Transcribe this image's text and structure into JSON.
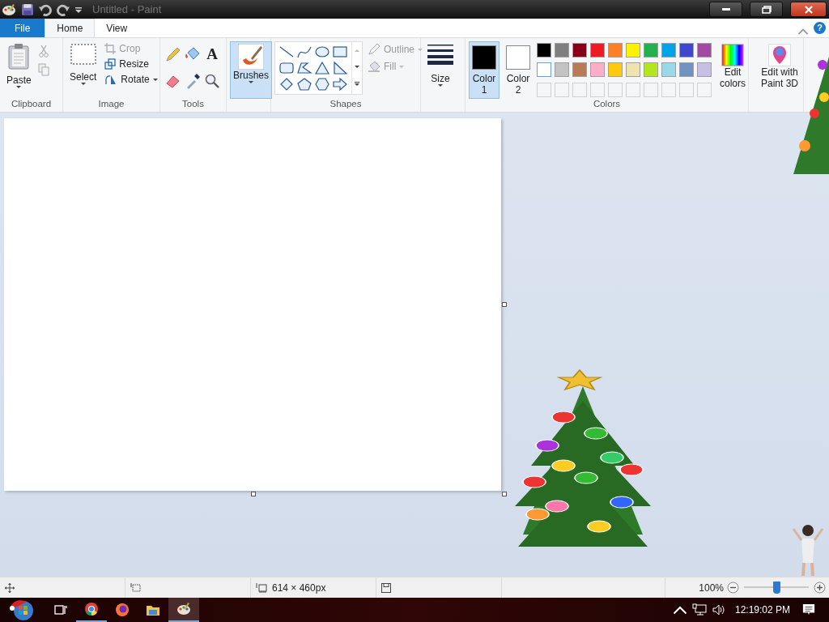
{
  "window": {
    "title": "Untitled - Paint"
  },
  "tabs": [
    {
      "label": "File",
      "selected": false,
      "kind": "file"
    },
    {
      "label": "Home",
      "selected": true,
      "kind": "tab"
    },
    {
      "label": "View",
      "selected": false,
      "kind": "tab"
    }
  ],
  "clipboard": {
    "title": "Clipboard",
    "paste": "Paste"
  },
  "image": {
    "title": "Image",
    "select": "Select",
    "items": [
      {
        "label": "Crop",
        "disabled": true,
        "kind": "crop"
      },
      {
        "label": "Resize",
        "disabled": false,
        "kind": "resize"
      },
      {
        "label": "Rotate",
        "disabled": false,
        "kind": "rotate"
      }
    ]
  },
  "tools": {
    "title": "Tools",
    "text_tool": "A"
  },
  "help": "?",
  "brushes": {
    "label": "Brushes",
    "selected": true
  },
  "shapes": {
    "title": "Shapes",
    "outline": {
      "label": "Outline",
      "disabled": true
    },
    "fill": {
      "label": "Fill",
      "disabled": true
    }
  },
  "size": {
    "label": "Size"
  },
  "colors": {
    "title": "Colors",
    "active": [
      {
        "label": "Color 1",
        "color": "#000000",
        "selected": true
      },
      {
        "label": "Color 2",
        "color": "#ffffff",
        "selected": false
      }
    ],
    "palette": [
      {
        "color": "#000000"
      },
      {
        "color": "#7f7f7f"
      },
      {
        "color": "#880015"
      },
      {
        "color": "#ed1c24"
      },
      {
        "color": "#ff7f27"
      },
      {
        "color": "#fff200"
      },
      {
        "color": "#22b14c"
      },
      {
        "color": "#00a2e8"
      },
      {
        "color": "#3f48cc"
      },
      {
        "color": "#a349a4"
      },
      {
        "color": "#ffffff"
      },
      {
        "color": "#c3c3c3"
      },
      {
        "color": "#b97a57"
      },
      {
        "color": "#ffaec9"
      },
      {
        "color": "#ffc90e"
      },
      {
        "color": "#efe4b0"
      },
      {
        "color": "#b5e61d"
      },
      {
        "color": "#99d9ea"
      },
      {
        "color": "#7092be"
      },
      {
        "color": "#c8bfe7"
      }
    ],
    "custom": [
      {
        "filled": false
      },
      {
        "filled": false
      },
      {
        "filled": false
      },
      {
        "filled": false
      },
      {
        "filled": false
      },
      {
        "filled": false
      },
      {
        "filled": false
      },
      {
        "filled": false
      },
      {
        "filled": false
      },
      {
        "filled": false
      }
    ],
    "edit": "Edit colors"
  },
  "paint3d": {
    "label": "Edit with Paint 3D"
  },
  "status_bar": {
    "image_size": "614 × 460px",
    "zoom": "100%",
    "level": 0.5
  },
  "taskbar": {
    "apps": [
      {
        "kind": "chrome",
        "selected": false,
        "running": true
      },
      {
        "kind": "firefox",
        "selected": false,
        "running": false
      },
      {
        "kind": "explorer",
        "selected": false,
        "running": false
      },
      {
        "kind": "paint",
        "selected": true,
        "running": true
      }
    ],
    "clock": "12:19:02 PM"
  }
}
